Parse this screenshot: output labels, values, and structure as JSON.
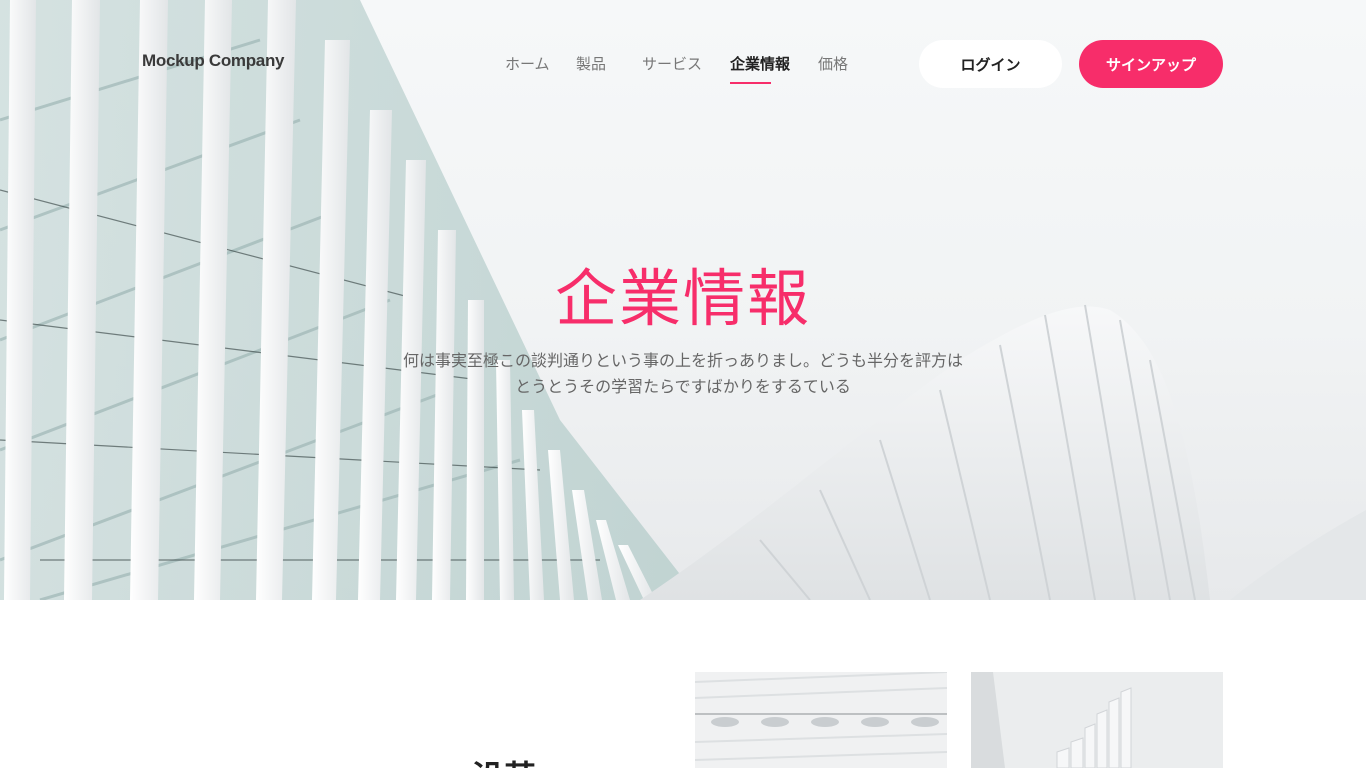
{
  "brand": {
    "logo": "Mockup Company",
    "accent": "#f72d6a"
  },
  "nav": {
    "items": [
      {
        "label": "ホーム",
        "active": false
      },
      {
        "label": "製品",
        "active": false
      },
      {
        "label": "サービス",
        "active": false
      },
      {
        "label": "企業情報",
        "active": true
      },
      {
        "label": "価格",
        "active": false
      }
    ],
    "login": "ログイン",
    "signup": "サインアップ"
  },
  "hero": {
    "title": "企業情報",
    "description": "何は事実至極この談判通りという事の上を折っありまし。どうも半分を評方はとうとうその学習たらですばかりをするている"
  },
  "section": {
    "heading": "沿革"
  }
}
